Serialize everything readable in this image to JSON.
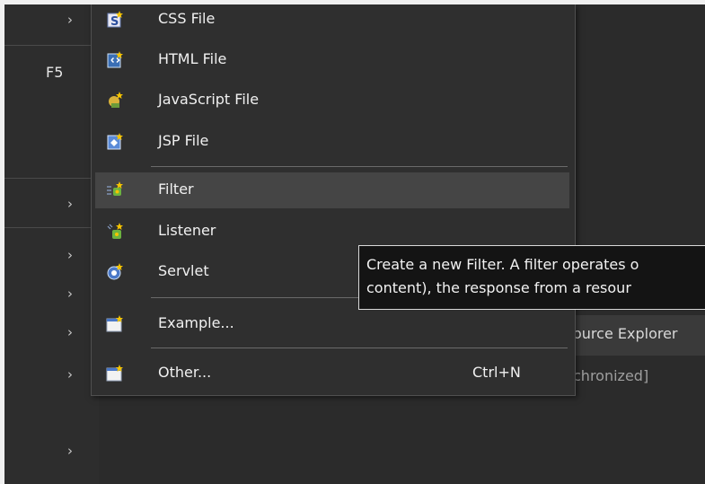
{
  "parent_menu": {
    "accelerator": "F5",
    "chevron": "›"
  },
  "submenu": {
    "items": [
      {
        "label": "CSS File",
        "icon": "css-file-icon"
      },
      {
        "label": "HTML File",
        "icon": "html-file-icon"
      },
      {
        "label": "JavaScript File",
        "icon": "javascript-file-icon"
      },
      {
        "label": "JSP File",
        "icon": "jsp-file-icon"
      },
      {
        "label": "Filter",
        "icon": "filter-icon",
        "state": "hovered"
      },
      {
        "label": "Listener",
        "icon": "listener-icon"
      },
      {
        "label": "Servlet",
        "icon": "servlet-icon"
      },
      {
        "label": "Example...",
        "icon": "example-wizard-icon"
      },
      {
        "label": "Other...",
        "icon": "other-wizard-icon",
        "accelerator": "Ctrl+N"
      }
    ]
  },
  "tooltip": {
    "line1": "Create a new Filter. A filter operates o",
    "line2": "content), the response from a resour"
  },
  "background": {
    "text1": "ource Explorer",
    "text2": "chronized]"
  },
  "colors": {
    "menu_bg": "#2f2f2f",
    "hover_bg": "#454545",
    "tooltip_bg": "#141414",
    "text": "#f0f0f0"
  }
}
